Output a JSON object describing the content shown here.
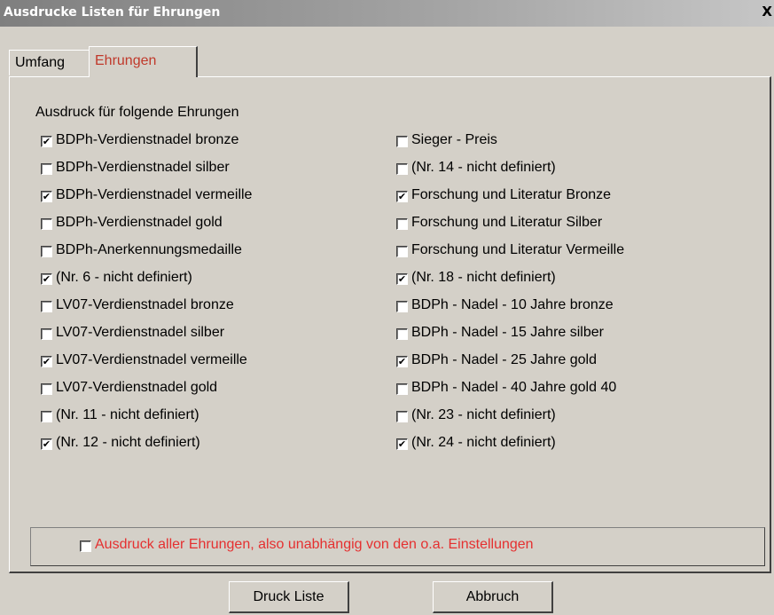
{
  "window": {
    "title": "Ausdrucke Listen für Ehrungen",
    "close_glyph": "X"
  },
  "tabs": [
    {
      "label": "Umfang",
      "active": false
    },
    {
      "label": "Ehrungen",
      "active": true
    }
  ],
  "section_heading": "Ausdruck für folgende Ehrungen",
  "left_column": [
    {
      "label": "BDPh-Verdienstnadel bronze",
      "checked": true
    },
    {
      "label": "BDPh-Verdienstnadel silber",
      "checked": false
    },
    {
      "label": "BDPh-Verdienstnadel vermeille",
      "checked": true
    },
    {
      "label": "BDPh-Verdienstnadel gold",
      "checked": false
    },
    {
      "label": "BDPh-Anerkennungsmedaille",
      "checked": false
    },
    {
      "label": "(Nr. 6 - nicht definiert)",
      "checked": true
    },
    {
      "label": "LV07-Verdienstnadel bronze",
      "checked": false
    },
    {
      "label": "LV07-Verdienstnadel silber",
      "checked": false
    },
    {
      "label": "LV07-Verdienstnadel vermeille",
      "checked": true
    },
    {
      "label": "LV07-Verdienstnadel gold",
      "checked": false
    },
    {
      "label": "(Nr. 11 - nicht definiert)",
      "checked": false
    },
    {
      "label": "(Nr. 12 - nicht definiert)",
      "checked": true
    }
  ],
  "right_column": [
    {
      "label": "Sieger - Preis",
      "checked": false
    },
    {
      "label": "(Nr. 14 - nicht definiert)",
      "checked": false
    },
    {
      "label": "Forschung und Literatur Bronze",
      "checked": true
    },
    {
      "label": "Forschung und Literatur Silber",
      "checked": false
    },
    {
      "label": "Forschung und Literatur Vermeille",
      "checked": false
    },
    {
      "label": "(Nr. 18 - nicht definiert)",
      "checked": true
    },
    {
      "label": "BDPh - Nadel - 10 Jahre bronze",
      "checked": false
    },
    {
      "label": "BDPh - Nadel - 15 Jahre silber",
      "checked": false
    },
    {
      "label": "BDPh - Nadel - 25 Jahre gold",
      "checked": true
    },
    {
      "label": "BDPh - Nadel - 40 Jahre gold   40",
      "checked": false
    },
    {
      "label": "(Nr. 23 - nicht definiert)",
      "checked": false
    },
    {
      "label": "(Nr. 24 - nicht definiert)",
      "checked": true
    }
  ],
  "all_option": {
    "label": "Ausdruck aller Ehrungen, also unabhängig von den o.a. Einstellungen",
    "checked": false,
    "color": "#e53030"
  },
  "buttons": {
    "print": "Druck Liste",
    "cancel": "Abbruch"
  },
  "colors": {
    "dialog_bg": "#d4d0c8",
    "accent_red": "#e53030"
  },
  "check_glyph": "✔"
}
